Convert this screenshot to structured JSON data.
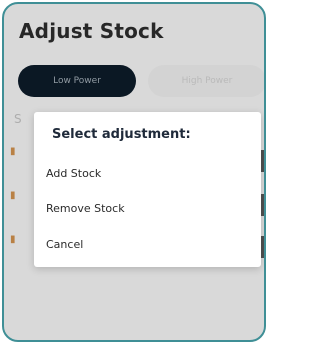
{
  "screen": {
    "title": "Adjust Stock",
    "segments": [
      {
        "label": "Low Power",
        "active": true
      },
      {
        "label": "High Power",
        "active": false
      }
    ],
    "section_label_partial": "S"
  },
  "dialog": {
    "title": "Select adjustment:",
    "options": [
      "Add Stock",
      "Remove Stock",
      "Cancel"
    ]
  },
  "colors": {
    "border": "#3f8f96",
    "active_segment": "#0c1a27"
  }
}
